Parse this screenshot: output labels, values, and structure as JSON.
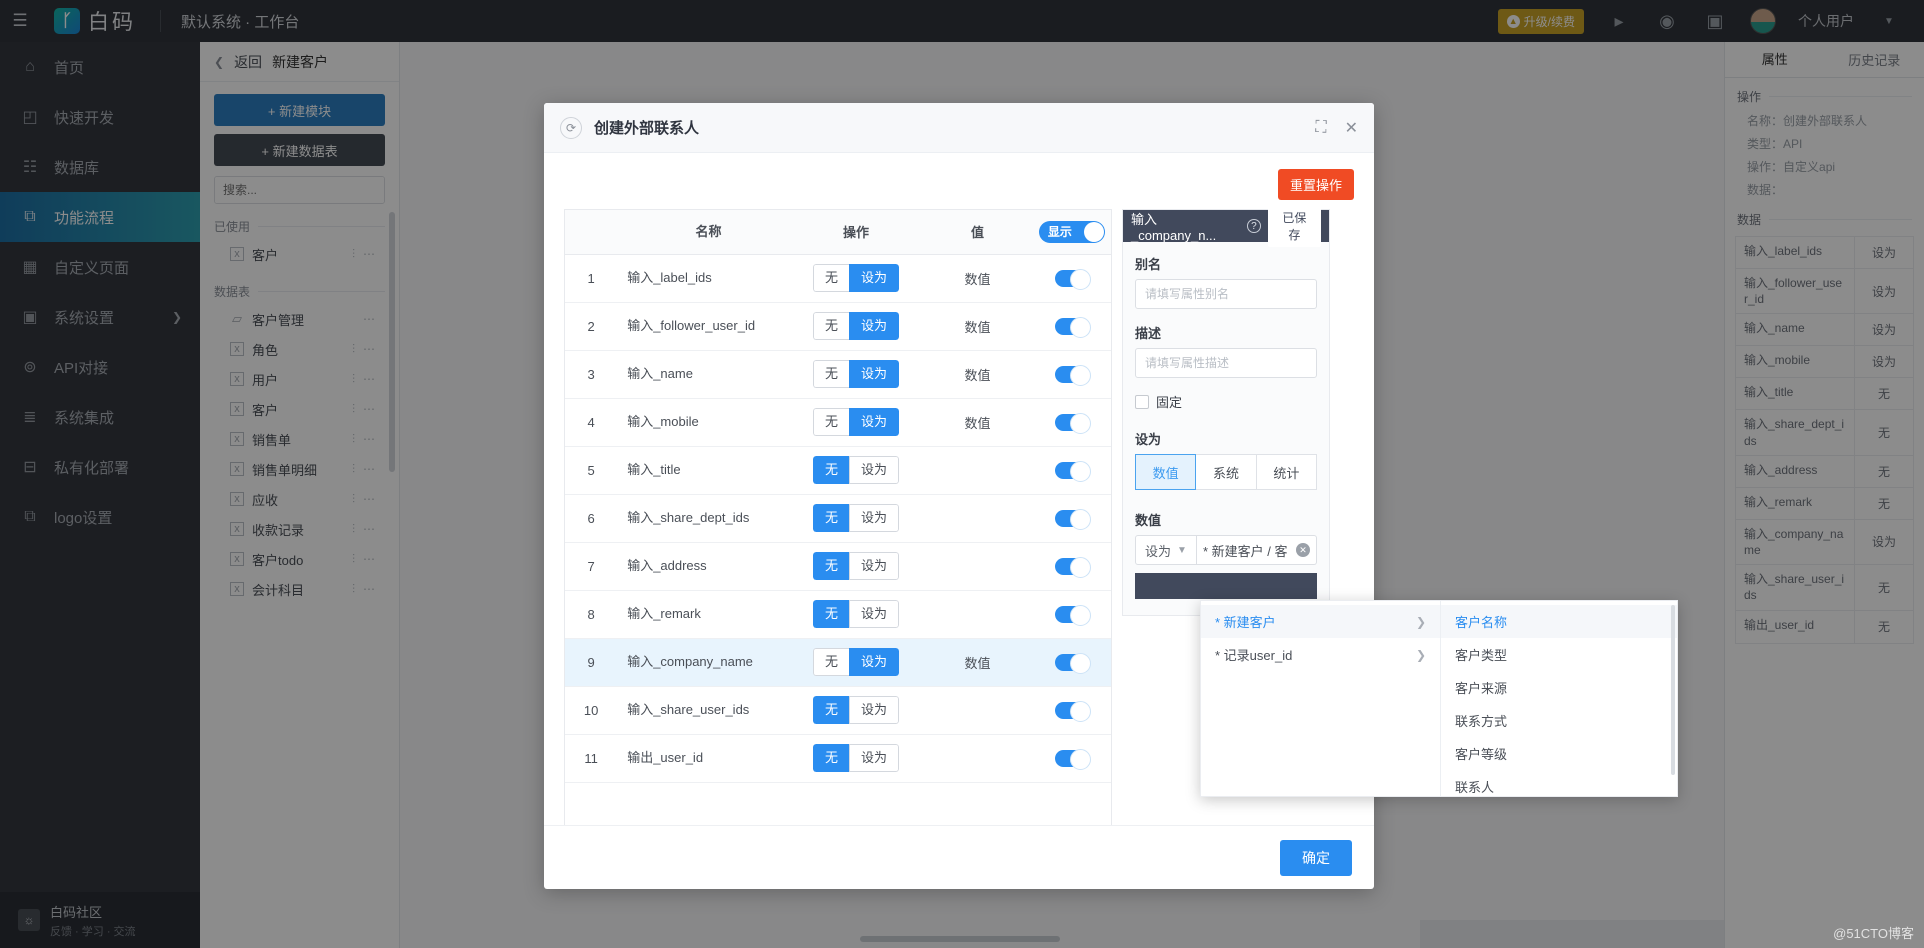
{
  "topbar": {
    "menu_icon": "hamburger-icon",
    "logo_text": "白码",
    "workspace": "默认系统 · 工作台",
    "upgrade_label": "升级/续费",
    "icons": [
      "play-circle-icon",
      "headset-icon",
      "help-book-icon"
    ],
    "username": "个人用户"
  },
  "leftnav": {
    "items": [
      {
        "label": "首页",
        "icon": "home-icon",
        "active": false,
        "chevron": false
      },
      {
        "label": "快速开发",
        "icon": "cube-icon",
        "active": false,
        "chevron": false
      },
      {
        "label": "数据库",
        "icon": "database-icon",
        "active": false,
        "chevron": false
      },
      {
        "label": "功能流程",
        "icon": "flow-icon",
        "active": true,
        "chevron": false
      },
      {
        "label": "自定义页面",
        "icon": "page-icon",
        "active": false,
        "chevron": false
      },
      {
        "label": "系统设置",
        "icon": "monitor-icon",
        "active": false,
        "chevron": true
      },
      {
        "label": "API对接",
        "icon": "api-icon",
        "active": false,
        "chevron": false
      },
      {
        "label": "系统集成",
        "icon": "layers-icon",
        "active": false,
        "chevron": false
      },
      {
        "label": "私有化部署",
        "icon": "lock-icon",
        "active": false,
        "chevron": false
      },
      {
        "label": "logo设置",
        "icon": "logo-icon",
        "active": false,
        "chevron": false
      }
    ],
    "footer_title": "白码社区",
    "footer_sub": "反馈 · 学习 · 交流"
  },
  "modpanel": {
    "back_label": "返回",
    "breadcrumb": "新建客户",
    "new_module": "+  新建模块",
    "new_table": "+  新建数据表",
    "search_placeholder": "搜索...",
    "group_used": "已使用",
    "group_tables": "数据表",
    "used_items": [
      {
        "label": "客户",
        "icon": "sheet-icon",
        "tools": true
      }
    ],
    "table_items": [
      {
        "label": "客户管理",
        "icon": "folder-icon",
        "tools": false
      },
      {
        "label": "角色",
        "icon": "sheet-icon",
        "tools": true
      },
      {
        "label": "用户",
        "icon": "sheet-icon",
        "tools": true
      },
      {
        "label": "客户",
        "icon": "sheet-icon",
        "tools": true
      },
      {
        "label": "销售单",
        "icon": "sheet-icon",
        "tools": true
      },
      {
        "label": "销售单明细",
        "icon": "sheet-icon",
        "tools": true
      },
      {
        "label": "应收",
        "icon": "sheet-icon",
        "tools": true
      },
      {
        "label": "收款记录",
        "icon": "sheet-icon",
        "tools": true
      },
      {
        "label": "客户todo",
        "icon": "sheet-icon",
        "tools": true
      },
      {
        "label": "会计科目",
        "icon": "sheet-icon",
        "tools": true
      }
    ]
  },
  "rightpanel": {
    "tabs": [
      {
        "label": "属性",
        "active": true
      },
      {
        "label": "历史记录",
        "active": false
      }
    ],
    "sec_operation": "操作",
    "kv": [
      {
        "k": "名称：",
        "v": "创建外部联系人"
      },
      {
        "k": "类型：",
        "v": "API"
      },
      {
        "k": "操作：",
        "v": "自定义api"
      },
      {
        "k": "数据：",
        "v": ""
      }
    ],
    "sec_data": "数据",
    "rows": [
      {
        "name": "输入_label_ids",
        "op": "设为"
      },
      {
        "name": "输入_follower_user_id",
        "op": "设为"
      },
      {
        "name": "输入_name",
        "op": "设为"
      },
      {
        "name": "输入_mobile",
        "op": "设为"
      },
      {
        "name": "输入_title",
        "op": "无"
      },
      {
        "name": "输入_share_dept_ids",
        "op": "无"
      },
      {
        "name": "输入_address",
        "op": "无"
      },
      {
        "name": "输入_remark",
        "op": "无"
      },
      {
        "name": "输入_company_name",
        "op": "设为"
      },
      {
        "name": "输入_share_user_ids",
        "op": "无"
      },
      {
        "name": "输出_user_id",
        "op": "无"
      }
    ]
  },
  "modal": {
    "title": "创建外部联系人",
    "refresh_icon": "refresh-icon",
    "expand_icon": "expand-icon",
    "close_icon": "close-icon",
    "reset_label": "重置操作",
    "confirm_label": "确定",
    "table": {
      "headers": [
        "",
        "名称",
        "操作",
        "值",
        "显示"
      ],
      "header_switch_label": "显示",
      "op_options": [
        "无",
        "设为"
      ],
      "rows": [
        {
          "idx": "1",
          "name": "输入_label_ids",
          "op": "设为",
          "value": "数值",
          "on": true,
          "selected": false
        },
        {
          "idx": "2",
          "name": "输入_follower_user_id",
          "op": "设为",
          "value": "数值",
          "on": true,
          "selected": false
        },
        {
          "idx": "3",
          "name": "输入_name",
          "op": "设为",
          "value": "数值",
          "on": true,
          "selected": false
        },
        {
          "idx": "4",
          "name": "输入_mobile",
          "op": "设为",
          "value": "数值",
          "on": true,
          "selected": false
        },
        {
          "idx": "5",
          "name": "输入_title",
          "op": "无",
          "value": "",
          "on": true,
          "selected": false
        },
        {
          "idx": "6",
          "name": "输入_share_dept_ids",
          "op": "无",
          "value": "",
          "on": true,
          "selected": false
        },
        {
          "idx": "7",
          "name": "输入_address",
          "op": "无",
          "value": "",
          "on": true,
          "selected": false
        },
        {
          "idx": "8",
          "name": "输入_remark",
          "op": "无",
          "value": "",
          "on": true,
          "selected": false
        },
        {
          "idx": "9",
          "name": "输入_company_name",
          "op": "设为",
          "value": "数值",
          "on": true,
          "selected": true
        },
        {
          "idx": "10",
          "name": "输入_share_user_ids",
          "op": "无",
          "value": "",
          "on": true,
          "selected": false
        },
        {
          "idx": "11",
          "name": "输出_user_id",
          "op": "无",
          "value": "",
          "on": true,
          "selected": false
        }
      ]
    },
    "property": {
      "title": "输入_company_n...",
      "help_icon": "question-icon",
      "saved_label": "已保存",
      "alias_label": "别名",
      "alias_placeholder": "请填写属性别名",
      "alias_value": "",
      "desc_label": "描述",
      "desc_placeholder": "请填写属性描述",
      "desc_value": "",
      "fixed_label": "固定",
      "fixed_checked": false,
      "setas_label": "设为",
      "setas_tabs": [
        {
          "label": "数值",
          "active": true
        },
        {
          "label": "系统",
          "active": false
        },
        {
          "label": "统计",
          "active": false
        }
      ],
      "value_label": "数值",
      "value_select": "设为",
      "value_field": "* 新建客户 / 客"
    }
  },
  "dropdown": {
    "left_items": [
      {
        "label": "* 新建客户",
        "active": true,
        "has_sub": true
      },
      {
        "label": "* 记录user_id",
        "active": false,
        "has_sub": true
      }
    ],
    "right_items": [
      {
        "label": "客户名称",
        "active": true
      },
      {
        "label": "客户类型",
        "active": false
      },
      {
        "label": "客户来源",
        "active": false
      },
      {
        "label": "联系方式",
        "active": false
      },
      {
        "label": "客户等级",
        "active": false
      },
      {
        "label": "联系人",
        "active": false
      }
    ]
  },
  "watermark": "@51CTO博客",
  "colors": {
    "accent_blue": "#2a8df0",
    "nav_active": "#1d6fa5",
    "reset_red": "#f04b24",
    "prop_header": "#41495c",
    "upgrade_gold": "#c9a227"
  }
}
